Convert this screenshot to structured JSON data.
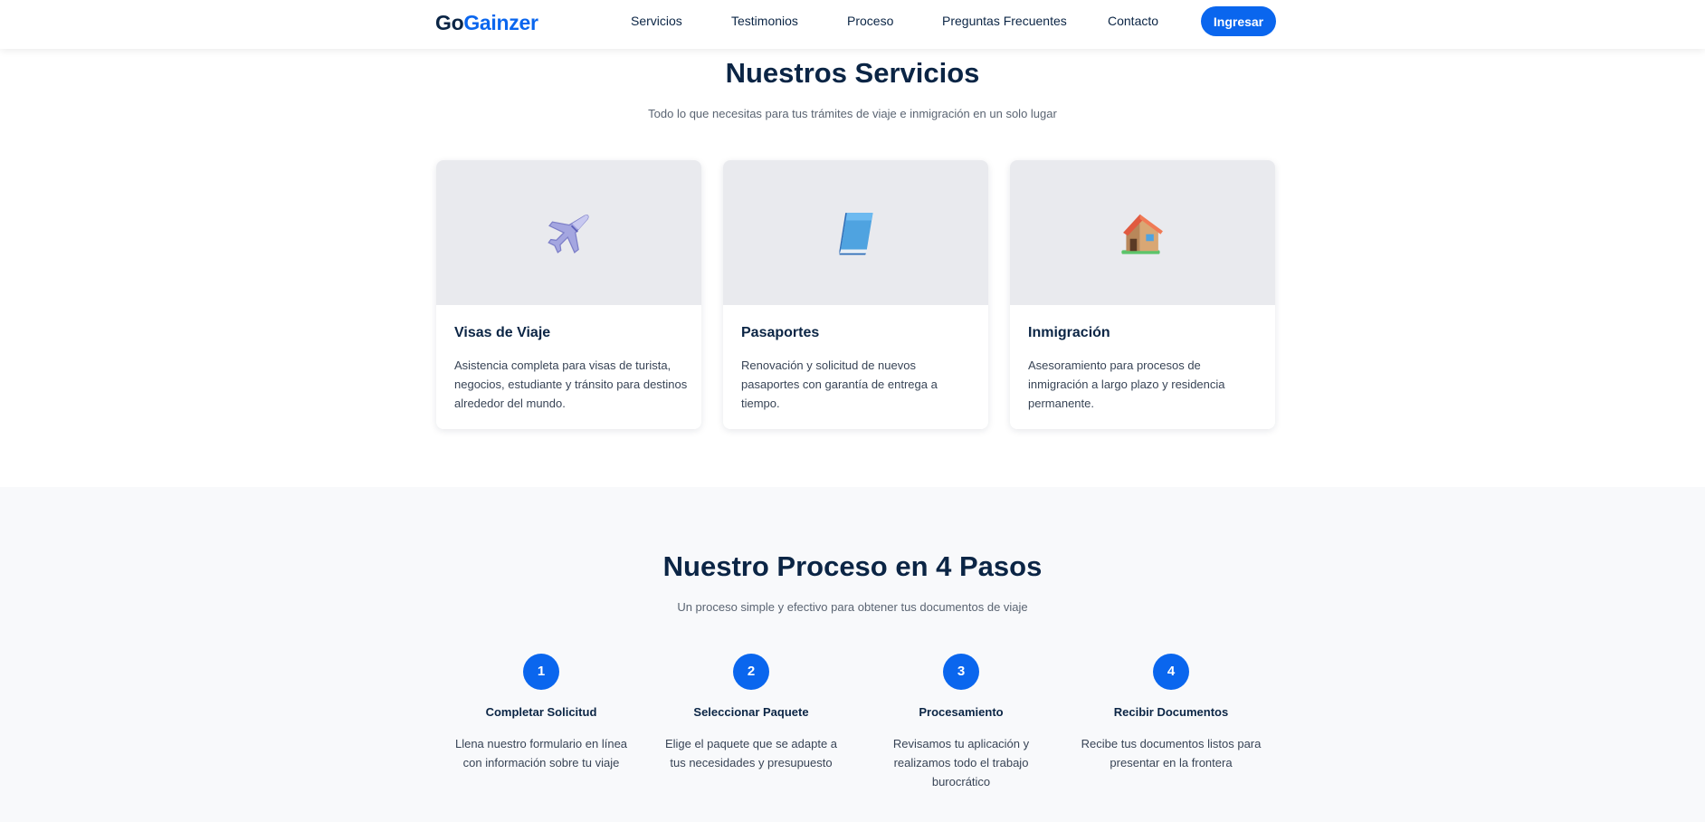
{
  "header": {
    "logo_part1": "Go",
    "logo_part2": "Gainzer",
    "nav": [
      "Servicios",
      "Testimonios",
      "Proceso",
      "Preguntas Frecuentes",
      "Contacto"
    ],
    "login_label": "Ingresar"
  },
  "services": {
    "title": "Nuestros Servicios",
    "subtitle": "Todo lo que necesitas para tus trámites de viaje e inmigración en un solo lugar",
    "cards": [
      {
        "icon": "airplane-icon",
        "title": "Visas de Viaje",
        "description": "Asistencia completa para visas de turista, negocios, estudiante y tránsito para destinos alrededor del mundo."
      },
      {
        "icon": "blue-book-icon",
        "title": "Pasaportes",
        "description": "Renovación y solicitud de nuevos pasaportes con garantía de entrega a tiempo."
      },
      {
        "icon": "house-icon",
        "title": "Inmigración",
        "description": "Asesoramiento para procesos de inmigración a largo plazo y residencia permanente."
      }
    ]
  },
  "process": {
    "title": "Nuestro Proceso en 4 Pasos",
    "subtitle": "Un proceso simple y efectivo para obtener tus documentos de viaje",
    "steps": [
      {
        "number": "1",
        "title": "Completar Solicitud",
        "description": "Llena nuestro formulario en línea con información sobre tu viaje"
      },
      {
        "number": "2",
        "title": "Seleccionar Paquete",
        "description": "Elige el paquete que se adapte a tus necesidades y presupuesto"
      },
      {
        "number": "3",
        "title": "Procesamiento",
        "description": "Revisamos tu aplicación y realizamos todo el trabajo burocrático"
      },
      {
        "number": "4",
        "title": "Recibir Documentos",
        "description": "Recibe tus documentos listos para presentar en la frontera"
      }
    ]
  },
  "colors": {
    "primary": "#0a66ee",
    "navy": "#0b2545",
    "card_bg": "#e9eaee",
    "section_bg": "#f8f9fb"
  }
}
